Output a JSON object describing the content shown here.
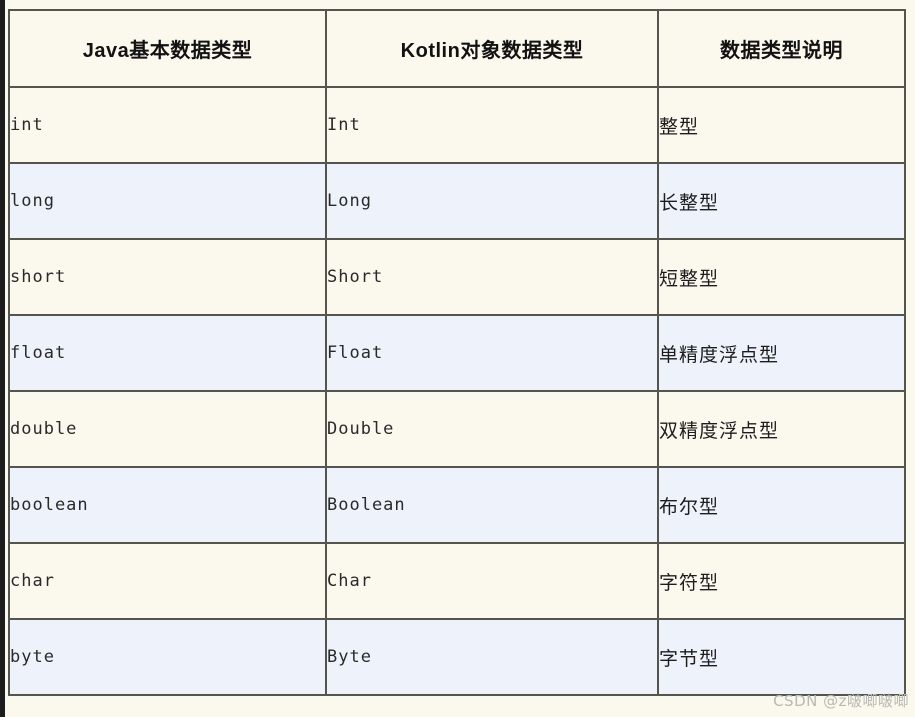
{
  "table": {
    "columns": [
      {
        "key": "java",
        "label": "Java基本数据类型"
      },
      {
        "key": "kotlin",
        "label": "Kotlin对象数据类型"
      },
      {
        "key": "desc",
        "label": "数据类型说明"
      }
    ],
    "rows": [
      {
        "java": "int",
        "kotlin": "Int",
        "desc": "整型",
        "shade": "cream"
      },
      {
        "java": "long",
        "kotlin": "Long",
        "desc": "长整型",
        "shade": "blue"
      },
      {
        "java": "short",
        "kotlin": "Short",
        "desc": "短整型",
        "shade": "cream"
      },
      {
        "java": "float",
        "kotlin": "Float",
        "desc": "单精度浮点型",
        "shade": "blue"
      },
      {
        "java": "double",
        "kotlin": "Double",
        "desc": "双精度浮点型",
        "shade": "cream"
      },
      {
        "java": "boolean",
        "kotlin": "Boolean",
        "desc": "布尔型",
        "shade": "blue"
      },
      {
        "java": "char",
        "kotlin": "Char",
        "desc": "字符型",
        "shade": "cream"
      },
      {
        "java": "byte",
        "kotlin": "Byte",
        "desc": "字节型",
        "shade": "blue"
      }
    ]
  },
  "watermark": {
    "text": "CSDN @z啵唧啵唧"
  },
  "colors": {
    "cream_row": "#fbf8ee",
    "blue_row": "#edf2fb",
    "border": "#555550",
    "outer_border": "#6b6b63",
    "text": "#1d1d1d",
    "watermark": "#b9b9b4"
  }
}
